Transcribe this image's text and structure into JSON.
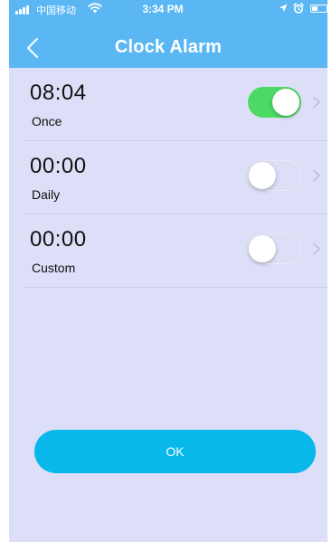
{
  "status_bar": {
    "carrier": "中国移动",
    "time": "3:34 PM",
    "battery_level": 0.4
  },
  "header": {
    "title": "Clock Alarm"
  },
  "alarms": [
    {
      "time": "08:04",
      "repeat": "Once",
      "enabled": true
    },
    {
      "time": "00:00",
      "repeat": "Daily",
      "enabled": false
    },
    {
      "time": "00:00",
      "repeat": "Custom",
      "enabled": false
    }
  ],
  "ok_button": {
    "label": "OK"
  },
  "colors": {
    "header": "#5ab7f3",
    "background": "#dcdff7",
    "toggle_on": "#4cd964",
    "ok_button": "#08b8ea"
  },
  "icons": {
    "back": "chevron-left-icon",
    "row_arrow": "chevron-right-icon",
    "signal": "signal-bars-icon",
    "wifi": "wifi-icon",
    "location": "location-arrow-icon",
    "alarm": "alarm-clock-icon",
    "battery": "battery-icon"
  }
}
